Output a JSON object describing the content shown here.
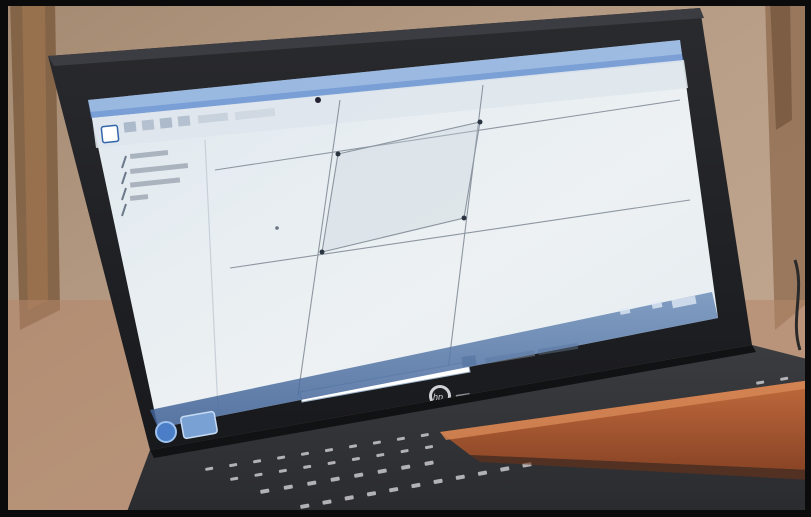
{
  "scene": {
    "description_type": "photograph",
    "colors": {
      "wall": "#b59a84",
      "wall_shadow": "#8a6e58",
      "wood_frame": "#8a5a2e",
      "laptop_bezel": "#1c1d20",
      "laptop_body": "#3a3b3e",
      "keyboard_deck": "#2b2c2f",
      "key": "#c9c9cc",
      "screen": "#e9eef2",
      "screen_taskbar": "#2f5fb0",
      "ruler": "#a0552e",
      "black_border": "#0b0b0b"
    }
  },
  "screen": {
    "app": "geometry-software",
    "sidebar_items": [],
    "toolbar_icons": [
      "square-icon",
      "tool-icon",
      "tool-icon",
      "tool-icon",
      "tool-icon"
    ],
    "input_bar_label": "",
    "taskbar_icons": [
      "start-orb-icon",
      "window-icon"
    ]
  },
  "laptop": {
    "logo": "hp-logo"
  }
}
